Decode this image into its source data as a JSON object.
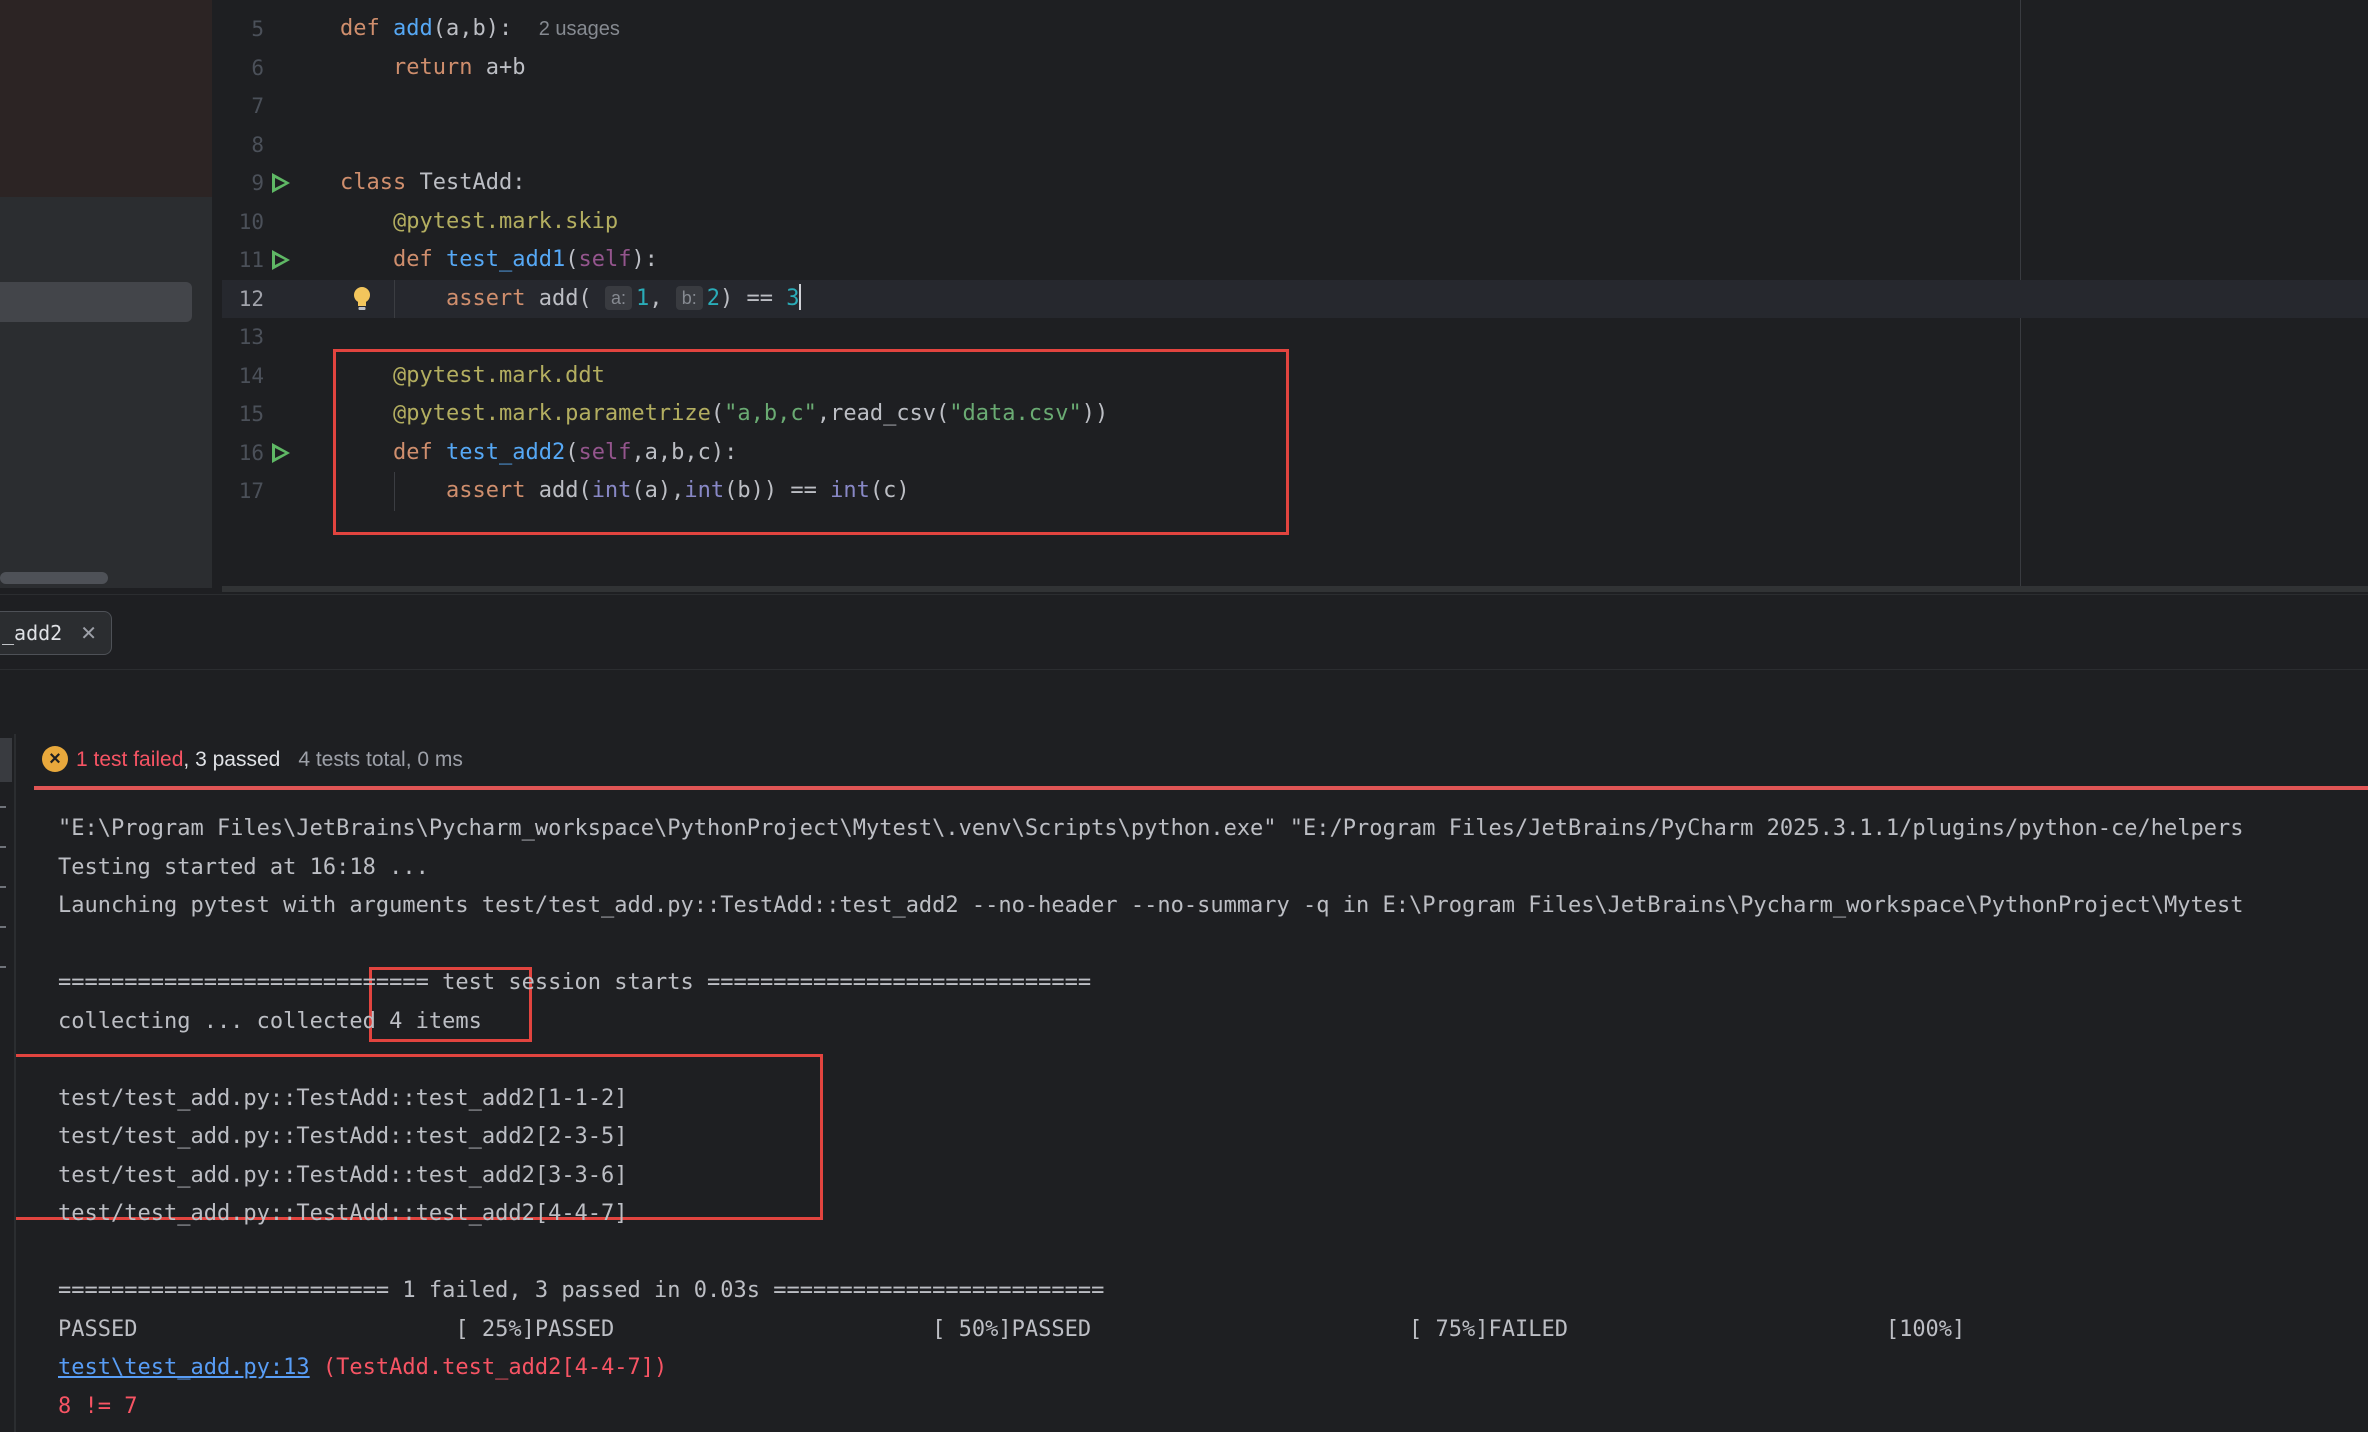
{
  "editor": {
    "lines": [
      {
        "n": "5",
        "html": "<span class=\"kw\">def</span> <span class=\"fn\">add</span>(a,b):  <span class=\"hint\">2 usages</span>"
      },
      {
        "n": "6",
        "html": "    <span class=\"kw\">return</span> a+b"
      },
      {
        "n": "7",
        "html": ""
      },
      {
        "n": "8",
        "html": ""
      },
      {
        "n": "9",
        "html": "<span class=\"kw\">class</span> TestAdd:",
        "run": true
      },
      {
        "n": "10",
        "html": "    <span class=\"dec\">@pytest.mark.skip</span>"
      },
      {
        "n": "11",
        "html": "    <span class=\"kw\">def</span> <span class=\"fn\">test_add1</span>(<span class=\"self\">self</span>):",
        "run": true
      },
      {
        "n": "12",
        "html": "        <span class=\"kw\">assert</span> add( <span class=\"param-hint\">a:</span><span class=\"num\">1</span>, <span class=\"param-hint\">b:</span><span class=\"num\">2</span>) == <span class=\"num\">3</span><span class=\"caret\"></span>",
        "current": true,
        "bulb": true
      },
      {
        "n": "13",
        "html": ""
      },
      {
        "n": "14",
        "html": "    <span class=\"dec\">@pytest.mark.ddt</span>"
      },
      {
        "n": "15",
        "html": "    <span class=\"dec\">@pytest.mark.parametrize</span>(<span class=\"str\">\"a,b,c\"</span>,read_csv(<span class=\"str\">\"data.csv\"</span>))"
      },
      {
        "n": "16",
        "html": "    <span class=\"kw\">def</span> <span class=\"fn\">test_add2</span>(<span class=\"self\">self</span>,a,b,c):",
        "run": true
      },
      {
        "n": "17",
        "html": "        <span class=\"kw\">assert</span> add(<span class=\"builtin\">int</span>(a),<span class=\"builtin\">int</span>(b)) == <span class=\"builtin\">int</span>(c)"
      }
    ]
  },
  "run": {
    "tab_label": "_add2",
    "status": {
      "failed": "1 test failed",
      "passed": ", 3 passed",
      "total": "4 tests total, 0 ms"
    },
    "console": [
      {
        "text": "\"E:\\Program Files\\JetBrains\\Pycharm_workspace\\PythonProject\\Mytest\\.venv\\Scripts\\python.exe\" \"E:/Program Files/JetBrains/PyCharm 2025.3.1.1/plugins/python-ce/helpers"
      },
      {
        "text": "Testing started at 16:18 ..."
      },
      {
        "text": "Launching pytest with arguments test/test_add.py::TestAdd::test_add2 --no-header --no-summary -q in E:\\Program Files\\JetBrains\\Pycharm_workspace\\PythonProject\\Mytest"
      },
      {
        "text": ""
      },
      {
        "text": "============================ test session starts ============================="
      },
      {
        "text": "collecting ... collected 4 items"
      },
      {
        "text": ""
      },
      {
        "text": "test/test_add.py::TestAdd::test_add2[1-1-2]"
      },
      {
        "text": "test/test_add.py::TestAdd::test_add2[2-3-5]"
      },
      {
        "text": "test/test_add.py::TestAdd::test_add2[3-3-6]"
      },
      {
        "text": "test/test_add.py::TestAdd::test_add2[4-4-7]"
      },
      {
        "text": ""
      },
      {
        "text": "========================= 1 failed, 3 passed in 0.03s ========================="
      },
      {
        "text": "PASSED                        [ 25%]PASSED                        [ 50%]PASSED                        [ 75%]FAILED                        [100%]"
      },
      {
        "link": "test\\test_add.py:13",
        "text": " (TestAdd.test_add2[4-4-7])",
        "err": true
      },
      {
        "text": "8 != 7",
        "err": true
      }
    ]
  }
}
